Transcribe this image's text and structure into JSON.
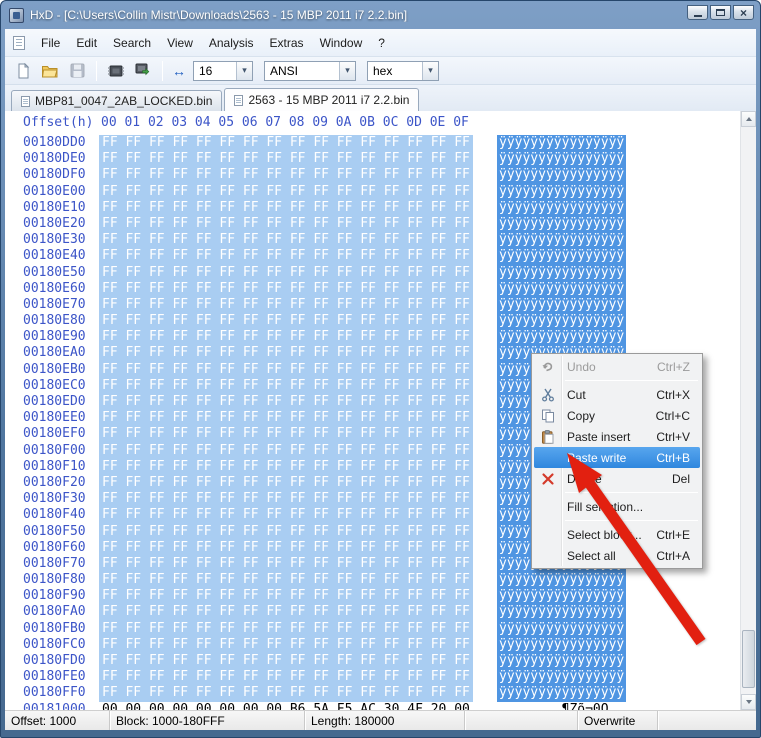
{
  "window": {
    "title": "HxD - [C:\\Users\\Collin Mistr\\Downloads\\2563 - 15 MBP 2011 i7 2.2.bin]"
  },
  "menubar": {
    "items": [
      "File",
      "Edit",
      "Search",
      "View",
      "Analysis",
      "Extras",
      "Window",
      "?"
    ]
  },
  "toolbar": {
    "buttons": [
      {
        "icon": "new-document",
        "disabled": false
      },
      {
        "icon": "open-file",
        "disabled": false
      },
      {
        "icon": "save",
        "disabled": true
      },
      {
        "icon": "open-memory",
        "disabled": false
      },
      {
        "icon": "open-disk",
        "disabled": false
      }
    ],
    "bytes_per_row": "16",
    "encoding": "ANSI",
    "offset_base": "hex"
  },
  "tabs": [
    {
      "label": "MBP81_0047_2AB_LOCKED.bin",
      "active": false
    },
    {
      "label": "2563 - 15 MBP 2011 i7 2.2.bin",
      "active": true
    }
  ],
  "hex_view": {
    "header_offset": "Offset(h)",
    "header_bytes": "00 01 02 03 04 05 06 07 08 09 0A 0B 0C 0D 0E 0F",
    "rows": [
      {
        "offset": "00180DD0",
        "bytes": "FF FF FF FF FF FF FF FF FF FF FF FF FF FF FF FF",
        "ascii": "ÿÿÿÿÿÿÿÿÿÿÿÿÿÿÿÿ",
        "selected": true
      },
      {
        "offset": "00180DE0",
        "bytes": "FF FF FF FF FF FF FF FF FF FF FF FF FF FF FF FF",
        "ascii": "ÿÿÿÿÿÿÿÿÿÿÿÿÿÿÿÿ",
        "selected": true
      },
      {
        "offset": "00180DF0",
        "bytes": "FF FF FF FF FF FF FF FF FF FF FF FF FF FF FF FF",
        "ascii": "ÿÿÿÿÿÿÿÿÿÿÿÿÿÿÿÿ",
        "selected": true
      },
      {
        "offset": "00180E00",
        "bytes": "FF FF FF FF FF FF FF FF FF FF FF FF FF FF FF FF",
        "ascii": "ÿÿÿÿÿÿÿÿÿÿÿÿÿÿÿÿ",
        "selected": true
      },
      {
        "offset": "00180E10",
        "bytes": "FF FF FF FF FF FF FF FF FF FF FF FF FF FF FF FF",
        "ascii": "ÿÿÿÿÿÿÿÿÿÿÿÿÿÿÿÿ",
        "selected": true
      },
      {
        "offset": "00180E20",
        "bytes": "FF FF FF FF FF FF FF FF FF FF FF FF FF FF FF FF",
        "ascii": "ÿÿÿÿÿÿÿÿÿÿÿÿÿÿÿÿ",
        "selected": true
      },
      {
        "offset": "00180E30",
        "bytes": "FF FF FF FF FF FF FF FF FF FF FF FF FF FF FF FF",
        "ascii": "ÿÿÿÿÿÿÿÿÿÿÿÿÿÿÿÿ",
        "selected": true
      },
      {
        "offset": "00180E40",
        "bytes": "FF FF FF FF FF FF FF FF FF FF FF FF FF FF FF FF",
        "ascii": "ÿÿÿÿÿÿÿÿÿÿÿÿÿÿÿÿ",
        "selected": true
      },
      {
        "offset": "00180E50",
        "bytes": "FF FF FF FF FF FF FF FF FF FF FF FF FF FF FF FF",
        "ascii": "ÿÿÿÿÿÿÿÿÿÿÿÿÿÿÿÿ",
        "selected": true
      },
      {
        "offset": "00180E60",
        "bytes": "FF FF FF FF FF FF FF FF FF FF FF FF FF FF FF FF",
        "ascii": "ÿÿÿÿÿÿÿÿÿÿÿÿÿÿÿÿ",
        "selected": true
      },
      {
        "offset": "00180E70",
        "bytes": "FF FF FF FF FF FF FF FF FF FF FF FF FF FF FF FF",
        "ascii": "ÿÿÿÿÿÿÿÿÿÿÿÿÿÿÿÿ",
        "selected": true
      },
      {
        "offset": "00180E80",
        "bytes": "FF FF FF FF FF FF FF FF FF FF FF FF FF FF FF FF",
        "ascii": "ÿÿÿÿÿÿÿÿÿÿÿÿÿÿÿÿ",
        "selected": true
      },
      {
        "offset": "00180E90",
        "bytes": "FF FF FF FF FF FF FF FF FF FF FF FF FF FF FF FF",
        "ascii": "ÿÿÿÿÿÿÿÿÿÿÿÿÿÿÿÿ",
        "selected": true
      },
      {
        "offset": "00180EA0",
        "bytes": "FF FF FF FF FF FF FF FF FF FF FF FF FF FF FF FF",
        "ascii": "ÿÿÿÿÿÿÿÿÿÿÿÿÿÿÿÿ",
        "selected": true
      },
      {
        "offset": "00180EB0",
        "bytes": "FF FF FF FF FF FF FF FF FF FF FF FF FF FF FF FF",
        "ascii": "ÿÿÿÿÿÿÿÿÿÿÿÿÿÿÿÿ",
        "selected": true
      },
      {
        "offset": "00180EC0",
        "bytes": "FF FF FF FF FF FF FF FF FF FF FF FF FF FF FF FF",
        "ascii": "ÿÿÿÿÿÿÿÿÿÿÿÿÿÿÿÿ",
        "selected": true
      },
      {
        "offset": "00180ED0",
        "bytes": "FF FF FF FF FF FF FF FF FF FF FF FF FF FF FF FF",
        "ascii": "ÿÿÿÿÿÿÿÿÿÿÿÿÿÿÿÿ",
        "selected": true
      },
      {
        "offset": "00180EE0",
        "bytes": "FF FF FF FF FF FF FF FF FF FF FF FF FF FF FF FF",
        "ascii": "ÿÿÿÿÿÿÿÿÿÿÿÿÿÿÿÿ",
        "selected": true
      },
      {
        "offset": "00180EF0",
        "bytes": "FF FF FF FF FF FF FF FF FF FF FF FF FF FF FF FF",
        "ascii": "ÿÿÿÿÿÿÿÿÿÿÿÿÿÿÿÿ",
        "selected": true
      },
      {
        "offset": "00180F00",
        "bytes": "FF FF FF FF FF FF FF FF FF FF FF FF FF FF FF FF",
        "ascii": "ÿÿÿÿÿÿÿÿÿÿÿÿÿÿÿÿ",
        "selected": true
      },
      {
        "offset": "00180F10",
        "bytes": "FF FF FF FF FF FF FF FF FF FF FF FF FF FF FF FF",
        "ascii": "ÿÿÿÿÿÿÿÿÿÿÿÿÿÿÿÿ",
        "selected": true
      },
      {
        "offset": "00180F20",
        "bytes": "FF FF FF FF FF FF FF FF FF FF FF FF FF FF FF FF",
        "ascii": "ÿÿÿÿÿÿÿÿÿÿÿÿÿÿÿÿ",
        "selected": true
      },
      {
        "offset": "00180F30",
        "bytes": "FF FF FF FF FF FF FF FF FF FF FF FF FF FF FF FF",
        "ascii": "ÿÿÿÿÿÿÿÿÿÿÿÿÿÿÿÿ",
        "selected": true
      },
      {
        "offset": "00180F40",
        "bytes": "FF FF FF FF FF FF FF FF FF FF FF FF FF FF FF FF",
        "ascii": "ÿÿÿÿÿÿÿÿÿÿÿÿÿÿÿÿ",
        "selected": true
      },
      {
        "offset": "00180F50",
        "bytes": "FF FF FF FF FF FF FF FF FF FF FF FF FF FF FF FF",
        "ascii": "ÿÿÿÿÿÿÿÿÿÿÿÿÿÿÿÿ",
        "selected": true
      },
      {
        "offset": "00180F60",
        "bytes": "FF FF FF FF FF FF FF FF FF FF FF FF FF FF FF FF",
        "ascii": "ÿÿÿÿÿÿÿÿÿÿÿÿÿÿÿÿ",
        "selected": true
      },
      {
        "offset": "00180F70",
        "bytes": "FF FF FF FF FF FF FF FF FF FF FF FF FF FF FF FF",
        "ascii": "ÿÿÿÿÿÿÿÿÿÿÿÿÿÿÿÿ",
        "selected": true
      },
      {
        "offset": "00180F80",
        "bytes": "FF FF FF FF FF FF FF FF FF FF FF FF FF FF FF FF",
        "ascii": "ÿÿÿÿÿÿÿÿÿÿÿÿÿÿÿÿ",
        "selected": true
      },
      {
        "offset": "00180F90",
        "bytes": "FF FF FF FF FF FF FF FF FF FF FF FF FF FF FF FF",
        "ascii": "ÿÿÿÿÿÿÿÿÿÿÿÿÿÿÿÿ",
        "selected": true
      },
      {
        "offset": "00180FA0",
        "bytes": "FF FF FF FF FF FF FF FF FF FF FF FF FF FF FF FF",
        "ascii": "ÿÿÿÿÿÿÿÿÿÿÿÿÿÿÿÿ",
        "selected": true
      },
      {
        "offset": "00180FB0",
        "bytes": "FF FF FF FF FF FF FF FF FF FF FF FF FF FF FF FF",
        "ascii": "ÿÿÿÿÿÿÿÿÿÿÿÿÿÿÿÿ",
        "selected": true
      },
      {
        "offset": "00180FC0",
        "bytes": "FF FF FF FF FF FF FF FF FF FF FF FF FF FF FF FF",
        "ascii": "ÿÿÿÿÿÿÿÿÿÿÿÿÿÿÿÿ",
        "selected": true
      },
      {
        "offset": "00180FD0",
        "bytes": "FF FF FF FF FF FF FF FF FF FF FF FF FF FF FF FF",
        "ascii": "ÿÿÿÿÿÿÿÿÿÿÿÿÿÿÿÿ",
        "selected": true
      },
      {
        "offset": "00180FE0",
        "bytes": "FF FF FF FF FF FF FF FF FF FF FF FF FF FF FF FF",
        "ascii": "ÿÿÿÿÿÿÿÿÿÿÿÿÿÿÿÿ",
        "selected": true
      },
      {
        "offset": "00180FF0",
        "bytes": "FF FF FF FF FF FF FF FF FF FF FF FF FF FF FF FF",
        "ascii": "ÿÿÿÿÿÿÿÿÿÿÿÿÿÿÿÿ",
        "selected": true
      },
      {
        "offset": "00181000",
        "bytes": "00 00 00 00 00 00 00 00 B6 5A F5 AC 30 4F 20 00",
        "ascii": "........¶Zõ¬0O .",
        "selected": false
      }
    ]
  },
  "context_menu": {
    "items": [
      {
        "label": "Undo",
        "shortcut": "Ctrl+Z",
        "icon": "undo",
        "state": "disabled"
      },
      {
        "type": "separator"
      },
      {
        "label": "Cut",
        "shortcut": "Ctrl+X",
        "icon": "cut"
      },
      {
        "label": "Copy",
        "shortcut": "Ctrl+C",
        "icon": "copy"
      },
      {
        "label": "Paste insert",
        "shortcut": "Ctrl+V",
        "icon": "paste"
      },
      {
        "label": "Paste write",
        "shortcut": "Ctrl+B",
        "state": "highlighted"
      },
      {
        "label": "Delete",
        "shortcut": "Del",
        "icon": "delete"
      },
      {
        "type": "separator"
      },
      {
        "label": "Fill selection...",
        "shortcut": ""
      },
      {
        "type": "separator"
      },
      {
        "label": "Select block...",
        "shortcut": "Ctrl+E"
      },
      {
        "label": "Select all",
        "shortcut": "Ctrl+A"
      }
    ]
  },
  "status_bar": {
    "offset": "Offset: 1000",
    "block": "Block: 1000-180FFF",
    "length": "Length: 180000",
    "mode": "Overwrite"
  },
  "colors": {
    "selection_hex_bg": "#a9cdf2",
    "selection_ascii_bg": "#4f95e2",
    "menu_highlight": "#3788dd",
    "offset_text": "#3c55c8",
    "annotation_arrow": "#e22010"
  }
}
